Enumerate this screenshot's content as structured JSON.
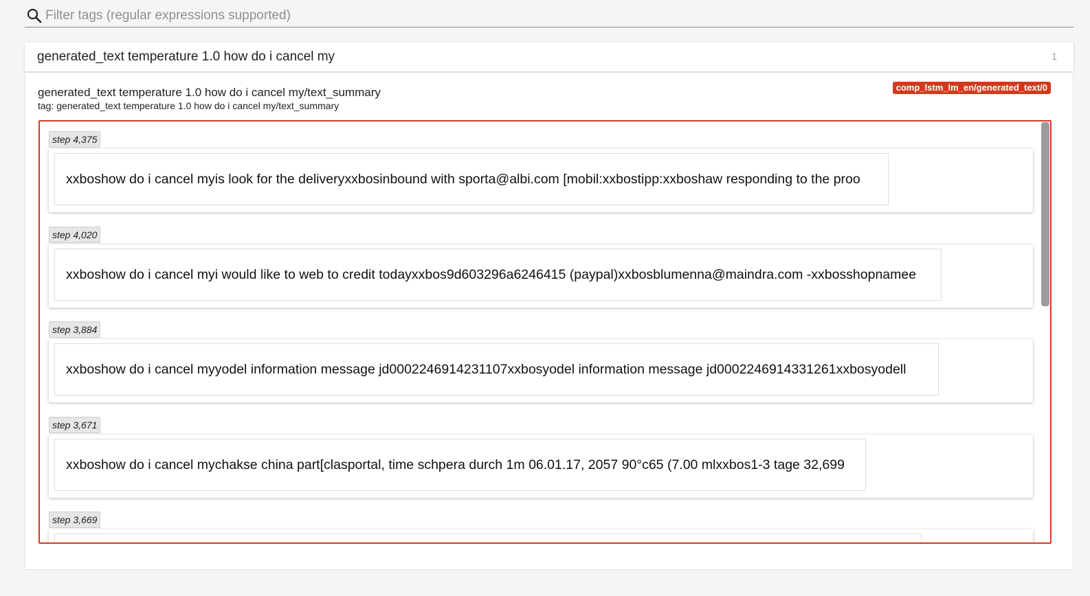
{
  "filter": {
    "placeholder": "Filter tags (regular expressions supported)",
    "icon": "search-icon"
  },
  "group": {
    "title": "generated_text temperature 1.0 how do i cancel my",
    "count": "1"
  },
  "card": {
    "title": "generated_text temperature 1.0 how do i cancel my/text_summary",
    "tag": "tag: generated_text temperature 1.0 how do i cancel my/text_summary",
    "run_badge": "comp_lstm_lm_en/generated_text/0",
    "run_badge_color": "#d13a1d",
    "frame_color": "#d33a24"
  },
  "steps": [
    {
      "label": "step 4,375",
      "text": "xxboshow do i cancel myis look for the deliveryxxbosinbound with sporta@albi.com [mobil:xxbostipp:xxboshaw responding to the proo"
    },
    {
      "label": "step 4,020",
      "text": "xxboshow do i cancel myi would like to web to credit todayxxbos9d603296a6246415 (paypal)xxbosblumenna@maindra.com -xxbosshopnamee"
    },
    {
      "label": "step 3,884",
      "text": "xxboshow do i cancel myyodel information message jd0002246914231107xxbosyodel information message jd0002246914331261xxbosyodell"
    },
    {
      "label": "step 3,671",
      "text": "xxboshow do i cancel mychakse china part[clasportal, time schpera durch 1m 06.01.17, 2057 90°c65 (7.00 mlxxbos1-3 tage 32,699"
    },
    {
      "label": "step 3,669",
      "text": ""
    }
  ]
}
